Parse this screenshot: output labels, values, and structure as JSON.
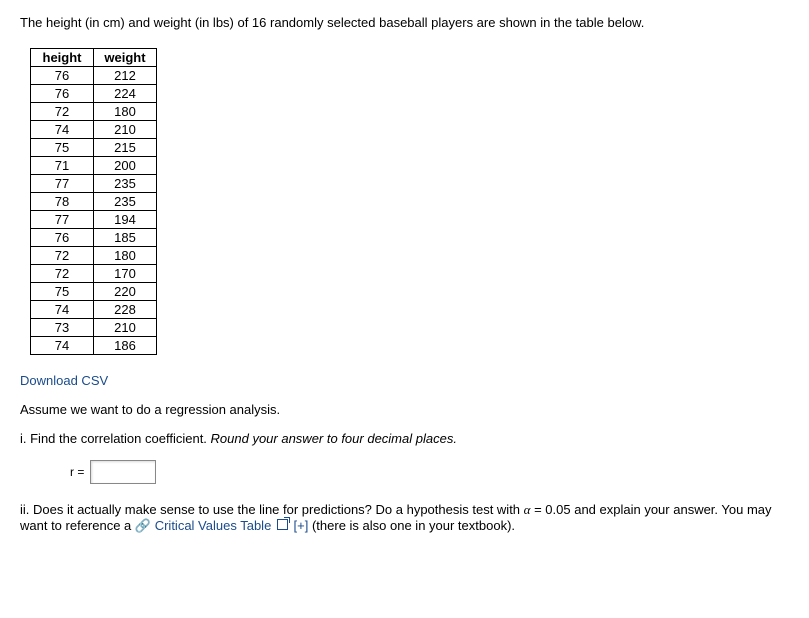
{
  "intro": "The height (in cm) and weight (in lbs) of 16 randomly selected baseball players are shown in the table below.",
  "table": {
    "headers": [
      "height",
      "weight"
    ],
    "rows": [
      [
        "76",
        "212"
      ],
      [
        "76",
        "224"
      ],
      [
        "72",
        "180"
      ],
      [
        "74",
        "210"
      ],
      [
        "75",
        "215"
      ],
      [
        "71",
        "200"
      ],
      [
        "77",
        "235"
      ],
      [
        "78",
        "235"
      ],
      [
        "77",
        "194"
      ],
      [
        "76",
        "185"
      ],
      [
        "72",
        "180"
      ],
      [
        "72",
        "170"
      ],
      [
        "75",
        "220"
      ],
      [
        "74",
        "228"
      ],
      [
        "73",
        "210"
      ],
      [
        "74",
        "186"
      ]
    ]
  },
  "download": "Download CSV",
  "assume": "Assume we want to do a regression analysis.",
  "q1": {
    "prefix": "i. Find the correlation coefficient.  ",
    "hint": "Round your answer to four decimal places.",
    "label": "r ="
  },
  "q2": {
    "part1": "ii. Does it actually make sense to use the line for predictions?  Do a hypothesis test with ",
    "alpha": "α",
    "eq": " = 0.05",
    "part2": " and explain your answer. You may want to reference a ",
    "linktext": "Critical Values Table",
    "plus": " [+]",
    "part3": " (there is also one in your textbook)."
  }
}
